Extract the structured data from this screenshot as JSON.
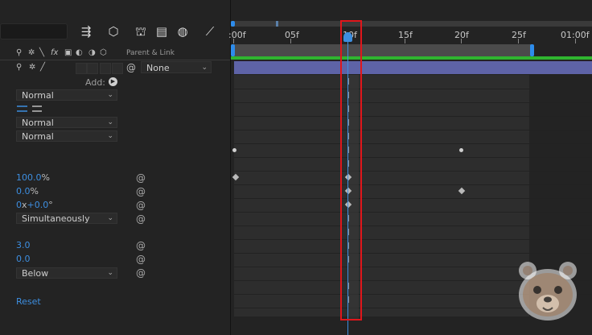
{
  "toolbar": {
    "icons": [
      "hierarchy-icon",
      "3d-cube-icon",
      "pin-icon",
      "film-icon",
      "motion-blur-icon",
      "graph-icon"
    ]
  },
  "switches_header": {
    "parent_link_label": "Parent & Link",
    "fx_label": "fx"
  },
  "layer": {
    "parent_value": "None"
  },
  "contents": {
    "add_label": "Add:"
  },
  "properties": {
    "blend_mode_1": "Normal",
    "blend_mode_2": "Normal",
    "blend_mode_3": "Normal",
    "opacity_value": "100.0",
    "opacity_unit": "%",
    "rotation_value": "0.0",
    "rotation_unit": "%",
    "offset_rotations": "0",
    "offset_x": "x",
    "offset_degrees": "+0.0",
    "offset_unit": "°",
    "composite_mode": "Simultaneously",
    "value_a": "3.0",
    "value_b": "0.0",
    "order_mode": "Below",
    "reset_label": "Reset"
  },
  "timeline": {
    "ruler_labels": [
      ":00f",
      "05f",
      "10f",
      "15f",
      "20f",
      "25f",
      "01:00f"
    ],
    "current_frame_label": "10f",
    "accent": "#3d8ee0",
    "layer_bar_color": "#5e63a7",
    "highlight_color": "#e0161b"
  }
}
